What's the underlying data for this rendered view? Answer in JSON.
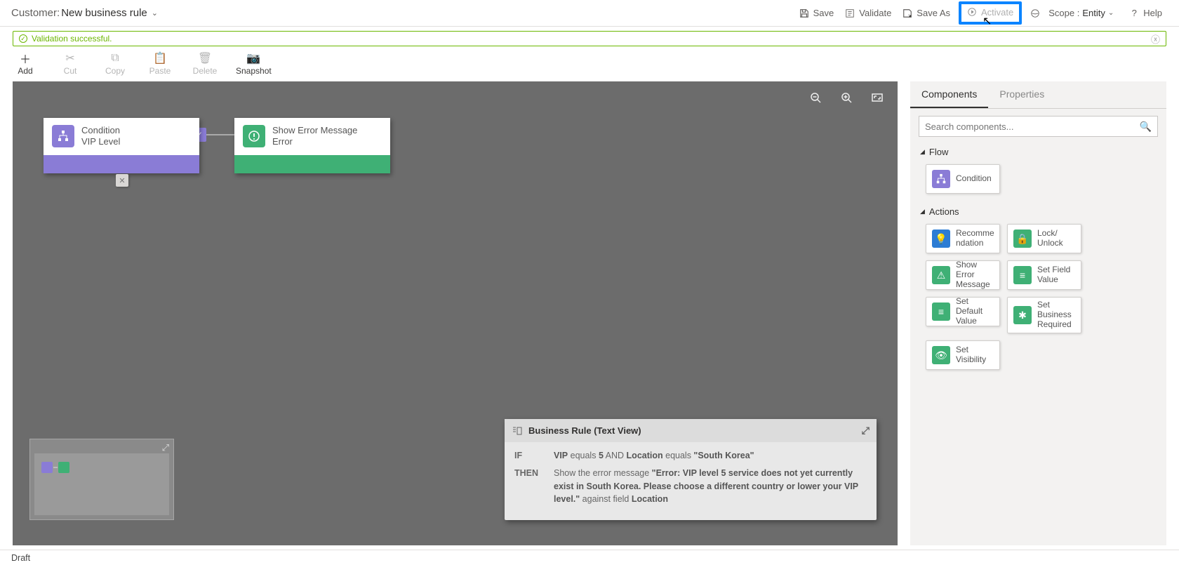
{
  "header": {
    "title_prefix": "Customer:",
    "title_name": "New business rule",
    "buttons": {
      "save": "Save",
      "validate": "Validate",
      "save_as": "Save As",
      "activate": "Activate",
      "scope_label": "Scope :",
      "scope_value": "Entity",
      "help": "Help"
    }
  },
  "validation": {
    "message": "Validation successful."
  },
  "toolbar": {
    "add": "Add",
    "cut": "Cut",
    "copy": "Copy",
    "paste": "Paste",
    "delete": "Delete",
    "snapshot": "Snapshot"
  },
  "canvas": {
    "nodes": {
      "condition": {
        "title": "Condition",
        "subtitle": "VIP Level"
      },
      "action": {
        "title": "Show Error Message",
        "subtitle": "Error"
      }
    }
  },
  "textview": {
    "title": "Business Rule (Text View)",
    "if_kw": "IF",
    "then_kw": "THEN",
    "if_parts": {
      "f1": "VIP",
      "op1": " equals ",
      "v1": "5",
      "and": " AND ",
      "f2": "Location",
      "op2": " equals ",
      "v2": "\"South Korea\""
    },
    "then_parts": {
      "pre": "Show the error message ",
      "msg": "\"Error: VIP level 5 service does not yet currently exist in South Korea. Please choose a different country or lower your VIP level.\"",
      "mid": " against field ",
      "field": "Location"
    }
  },
  "sidepanel": {
    "tabs": {
      "components": "Components",
      "properties": "Properties"
    },
    "search_placeholder": "Search components...",
    "sections": {
      "flow": "Flow",
      "actions": "Actions"
    },
    "components": {
      "condition": "Condition",
      "recommendation": "Recomme\nndation",
      "lock_unlock": "Lock/\nUnlock",
      "show_error": "Show Error\nMessage",
      "set_field": "Set Field\nValue",
      "set_default": "Set Default\nValue",
      "set_required": "Set\nBusiness\nRequired",
      "set_visibility": "Set\nVisibility"
    }
  },
  "footer": {
    "status": "Draft"
  }
}
